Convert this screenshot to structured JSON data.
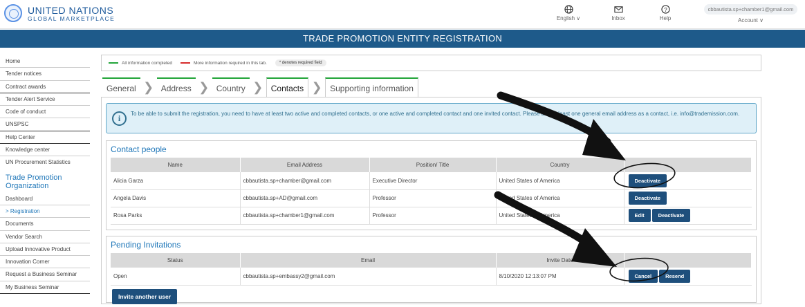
{
  "brand": {
    "line1": "UNITED NATIONS",
    "line2": "GLOBAL MARKETPLACE"
  },
  "topnav": [
    {
      "label": "English ∨",
      "icon": "globe-icon"
    },
    {
      "label": "Inbox",
      "icon": "mail-icon"
    },
    {
      "label": "Help",
      "icon": "help-icon"
    }
  ],
  "account": {
    "email": "cbbautista.sp+chamber1@gmail.com",
    "label": "Account ∨"
  },
  "banner": "TRADE PROMOTION ENTITY REGISTRATION",
  "sidebar": {
    "items_top": [
      "Home",
      "Tender notices",
      "Contract awards",
      "Tender Alert Service",
      "Code of conduct",
      "UNSPSC",
      "Help Center",
      "Knowledge center",
      "UN Procurement Statistics"
    ],
    "section_title": "Trade Promotion Organization",
    "items_bottom": [
      "Dashboard",
      "Registration",
      "Documents",
      "Vendor Search",
      "Upload Innovative Product",
      "Innovation Corner",
      "Request a Business Seminar",
      "My Business Seminar"
    ]
  },
  "legend": {
    "complete": "All information completed",
    "more": "More information required in this tab.",
    "required": "* denotes required field"
  },
  "tabs": [
    "General",
    "Address",
    "Country",
    "Contacts",
    "Supporting information"
  ],
  "info": "To be able to submit the registration, you need to have at least two active and completed contacts, or one active and completed contact and one invited contact. Please add at least one general email address as a contact, i.e. info@trademission.com.",
  "contact_people": {
    "title": "Contact people",
    "columns": [
      "Name",
      "Email Address",
      "Position/ Title",
      "Country",
      ""
    ],
    "rows": [
      {
        "name": "Alicia Garza",
        "email": "cbbautista.sp+chamber@gmail.com",
        "position": "Executive Director",
        "country": "United States of America",
        "actions": [
          "Deactivate"
        ]
      },
      {
        "name": "Angela Davis",
        "email": "cbbautista.sp+AD@gmail.com",
        "position": "Professor",
        "country": "United States of America",
        "actions": [
          "Deactivate"
        ]
      },
      {
        "name": "Rosa Parks",
        "email": "cbbautista.sp+chamber1@gmail.com",
        "position": "Professor",
        "country": "United States of America",
        "actions": [
          "Edit",
          "Deactivate"
        ]
      }
    ]
  },
  "pending": {
    "title": "Pending Invitations",
    "columns": [
      "Status",
      "Email",
      "Invite Date",
      ""
    ],
    "rows": [
      {
        "status": "Open",
        "email": "cbbautista.sp+embassy2@gmail.com",
        "date": "8/10/2020 12:13:07 PM",
        "actions": [
          "Cancel",
          "Resend"
        ]
      }
    ],
    "invite_button": "Invite another user"
  },
  "colors": {
    "banner": "#1e5a8a",
    "complete": "#22a539",
    "required": "#d62b2b",
    "button": "#1e4f7c",
    "link": "#1e76b8"
  }
}
